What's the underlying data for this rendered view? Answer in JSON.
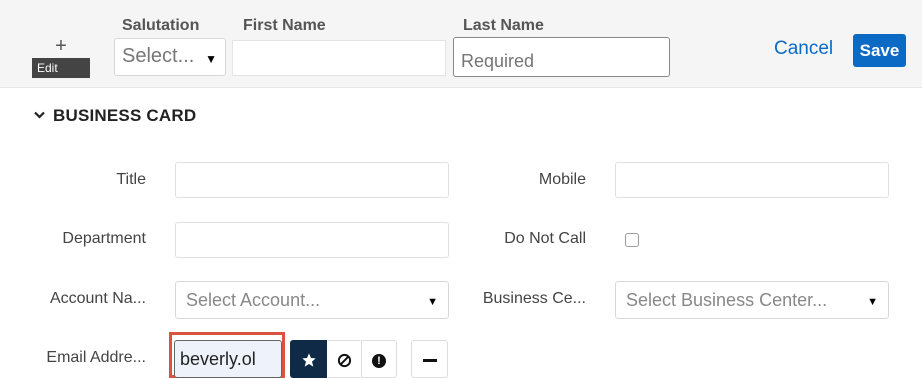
{
  "header": {
    "add_icon": "plus-icon",
    "add_symbol": "+",
    "edit_label": "Edit",
    "salutation_label": "Salutation",
    "salutation_value": "Select...",
    "first_name_label": "First Name",
    "first_name_value": "",
    "last_name_label": "Last Name",
    "last_name_placeholder": "Required",
    "cancel_label": "Cancel",
    "save_label": "Save"
  },
  "section": {
    "title": "BUSINESS CARD",
    "chevron_icon": "chevron-down-icon"
  },
  "fields": {
    "title_label": "Title",
    "mobile_label": "Mobile",
    "department_label": "Department",
    "do_not_call_label": "Do Not Call",
    "do_not_call_checked": false,
    "account_name_label": "Account Na...",
    "account_name_placeholder": "Select Account...",
    "business_center_label": "Business Ce...",
    "business_center_placeholder": "Select Business Center...",
    "email_label": "Email Addre...",
    "email_value": "beverly.ol"
  },
  "email_actions": {
    "primary_icon": "star-icon",
    "opt_out_icon": "prohibited-icon",
    "invalid_icon": "exclamation-icon",
    "remove_icon": "minus-icon"
  },
  "colors": {
    "accent": "#0b6ac4",
    "primary_email_button": "#0e2a47",
    "highlight": "#d9533f"
  }
}
